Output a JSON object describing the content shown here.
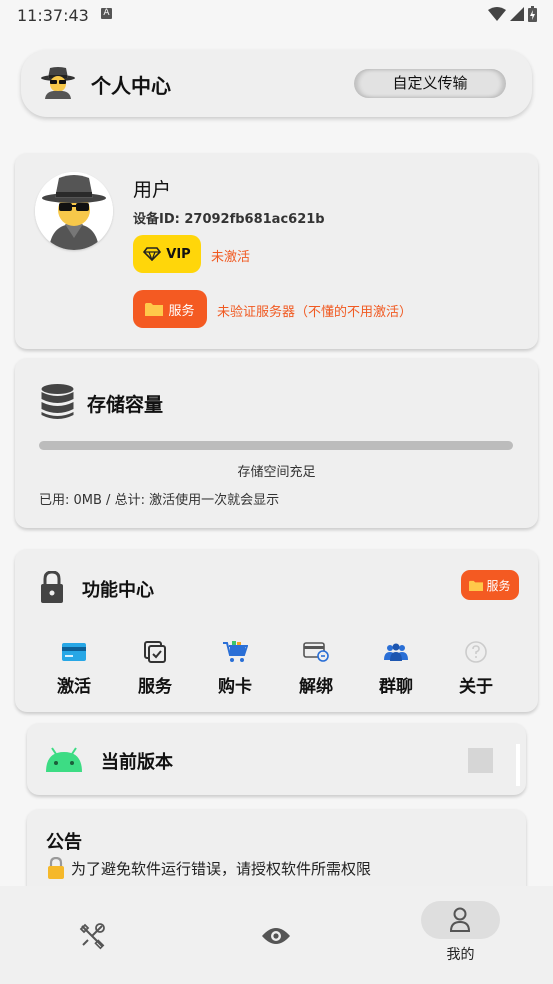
{
  "status_bar": {
    "time": "11:37:43",
    "notif_letter": "A"
  },
  "header": {
    "title": "个人中心",
    "custom_transfer_label": "自定义传输"
  },
  "user": {
    "name": "用户",
    "device_id": "设备ID: 27092fb681ac621b",
    "vip_label": "VIP",
    "vip_status": "未激活",
    "service_label": "服务",
    "service_status": "未验证服务器（不懂的不用激活）"
  },
  "storage": {
    "title": "存储容量",
    "progress_fraction": 0,
    "status": "存储空间充足",
    "usage": "已用: 0MB / 总计: 激活使用一次就会显示"
  },
  "functions": {
    "title": "功能中心",
    "service_button": "服务",
    "items": [
      {
        "label": "激活",
        "icon": "credit-card-icon"
      },
      {
        "label": "服务",
        "icon": "checklist-icon"
      },
      {
        "label": "购卡",
        "icon": "shopping-cart-icon"
      },
      {
        "label": "解绑",
        "icon": "unlink-card-icon"
      },
      {
        "label": "群聊",
        "icon": "group-icon"
      },
      {
        "label": "关于",
        "icon": "help-icon"
      }
    ]
  },
  "version": {
    "title": "当前版本"
  },
  "notice": {
    "title": "公告",
    "text": "为了避免软件运行错误，请授权软件所需权限"
  },
  "bottom_nav": {
    "items": [
      {
        "icon": "tools-icon",
        "label": ""
      },
      {
        "icon": "eye-icon",
        "label": ""
      },
      {
        "icon": "person-icon",
        "label": "我的"
      }
    ]
  },
  "colors": {
    "accent_orange": "#f45a22",
    "vip_yellow": "#ffd60a",
    "card_bg": "#efefef"
  }
}
